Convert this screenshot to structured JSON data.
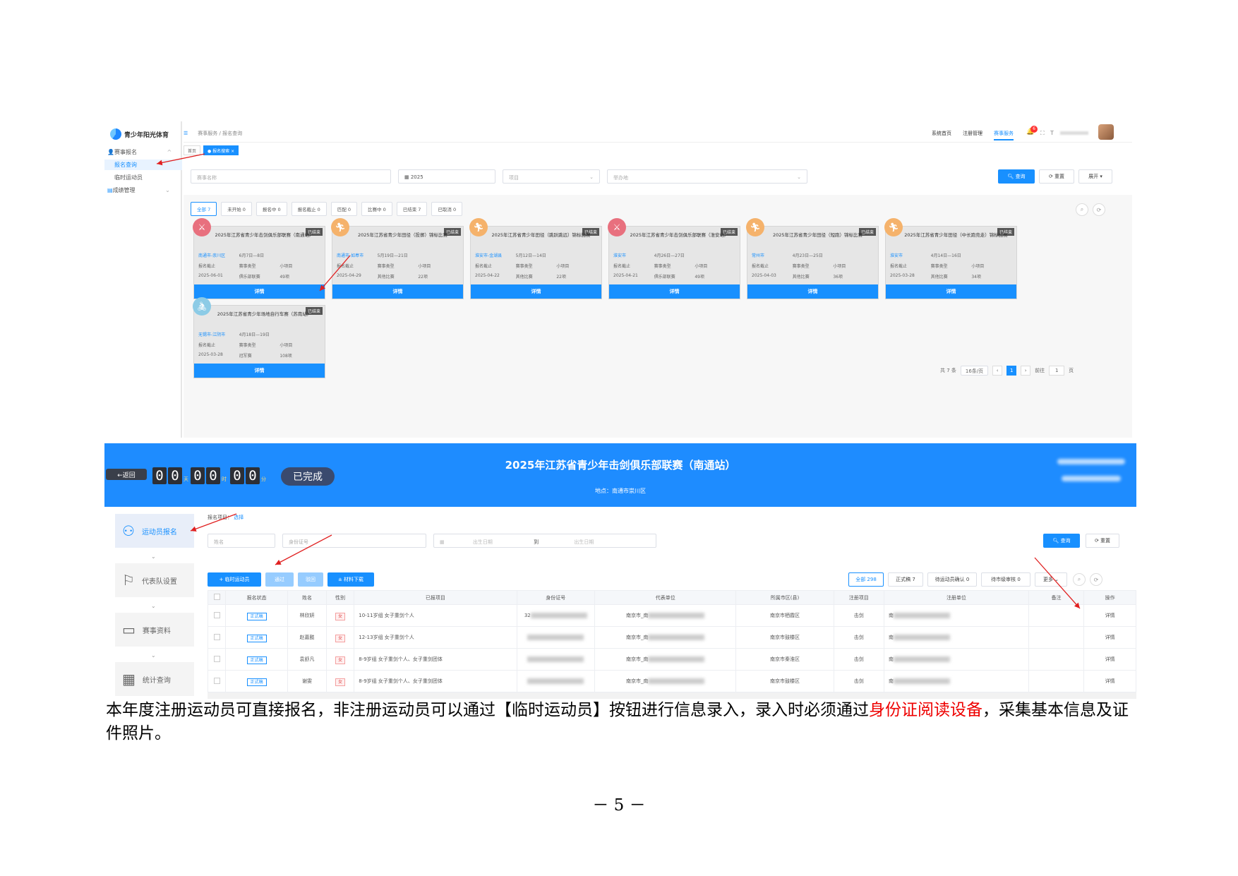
{
  "app": {
    "logo_text": "青少年阳光体育"
  },
  "sidebar": {
    "items": [
      {
        "label": "赛事报名"
      },
      {
        "label": "报名查询"
      },
      {
        "label": "临时运动员"
      },
      {
        "label": "成绩管理"
      }
    ]
  },
  "header": {
    "breadcrumb": "赛事服务 / 报名查询",
    "nav": [
      "系统首页",
      "注册管理",
      "赛事服务"
    ],
    "notification_count": "6",
    "tags": [
      "首页",
      "● 报名搜索 ×"
    ]
  },
  "filters": {
    "name_placeholder": "赛事名称",
    "year_value": "2025",
    "item_placeholder": "项目",
    "unit_placeholder": "举办地",
    "search_label": "查询",
    "reset_label": "重置",
    "expand_label": "展开"
  },
  "status_tabs": [
    "全部 7",
    "未开始 0",
    "报名中 0",
    "报名截止 0",
    "匹配 0",
    "比赛中 0",
    "已结束 7",
    "已取消 0"
  ],
  "cards": [
    {
      "title": "2025年江苏省青少年击剑俱乐部联赛（南通站）",
      "location": "南通市-崇川区",
      "dates": "6月7日—8日",
      "deadline_label": "报名截止",
      "type_label": "赛事类型",
      "sub_label": "小项目",
      "deadline": "2025-06-01",
      "type": "俱乐部联赛",
      "count": "49项",
      "status": "已结束",
      "detail": "详情",
      "icon": "fencing-icon",
      "color": "#e8707e"
    },
    {
      "title": "2025年江苏省青少年田径（投掷）锦标比赛",
      "location": "南通市-如皋市",
      "dates": "5月19日—21日",
      "deadline_label": "报名截止",
      "type_label": "赛事类型",
      "sub_label": "小项目",
      "deadline": "2025-04-29",
      "type": "其他比赛",
      "count": "22项",
      "status": "已结束",
      "detail": "详情",
      "icon": "running-icon",
      "color": "#f5b26b"
    },
    {
      "title": "2025年江苏省青少年田径（跳跃跳远）锦标比赛",
      "location": "淮安市-金湖县",
      "dates": "5月12日—14日",
      "deadline_label": "报名截止",
      "type_label": "赛事类型",
      "sub_label": "小项目",
      "deadline": "2025-04-22",
      "type": "其他比赛",
      "count": "22项",
      "status": "已结束",
      "detail": "详情",
      "icon": "running-icon",
      "color": "#f5b26b"
    },
    {
      "title": "2025年江苏省青少年击剑俱乐部联赛（淮安站）",
      "location": "淮安市",
      "dates": "4月26日—27日",
      "deadline_label": "报名截止",
      "type_label": "赛事类型",
      "sub_label": "小项目",
      "deadline": "2025-04-21",
      "type": "俱乐部联赛",
      "count": "49项",
      "status": "已结束",
      "detail": "详情",
      "icon": "fencing-icon",
      "color": "#e8707e"
    },
    {
      "title": "2025年江苏省青少年田径（短跑）锦标比赛",
      "location": "常州市",
      "dates": "4月23日—25日",
      "deadline_label": "报名截止",
      "type_label": "赛事类型",
      "sub_label": "小项目",
      "deadline": "2025-04-03",
      "type": "其他比赛",
      "count": "36项",
      "status": "已结束",
      "detail": "详情",
      "icon": "running-icon",
      "color": "#f5b26b"
    },
    {
      "title": "2025年江苏省青少年田径（中长跑竞走）锦标比赛",
      "location": "淮安市",
      "dates": "4月14日—16日",
      "deadline_label": "报名截止",
      "type_label": "赛事类型",
      "sub_label": "小项目",
      "deadline": "2025-03-28",
      "type": "其他比赛",
      "count": "34项",
      "status": "已结束",
      "detail": "详情",
      "icon": "running-icon",
      "color": "#f5b26b"
    },
    {
      "title": "2025年江苏省青少年场地自行车赛（苏南站）",
      "location": "无锡市-江阴市",
      "dates": "4月18日—19日",
      "deadline_label": "报名截止",
      "type_label": "赛事类型",
      "sub_label": "小项目",
      "deadline": "2025-03-28",
      "type": "冠军赛",
      "count": "108项",
      "status": "已结束",
      "detail": "详情",
      "icon": "cycling-icon",
      "color": "#8ccbe6"
    }
  ],
  "pagination": {
    "total": "共 7 条",
    "page_size": "16条/页",
    "current": "1",
    "goto_label": "前往",
    "goto_value": "1",
    "page_suffix": "页"
  },
  "event": {
    "back_label": "←返回",
    "countdown": {
      "d1": "0",
      "d2": "0",
      "day": "天",
      "h1": "0",
      "h2": "0",
      "hour": "时",
      "m1": "0",
      "m2": "0",
      "min": "分"
    },
    "status": "已完成",
    "title": "2025年江苏省青少年击剑俱乐部联赛（南通站）",
    "location": "地点：南通市崇川区"
  },
  "event_menu": [
    {
      "label": "运动员报名",
      "icon": "person-icon"
    },
    {
      "label": "代表队设置",
      "icon": "flag-icon"
    },
    {
      "label": "赛事资料",
      "icon": "folder-icon"
    },
    {
      "label": "统计查询",
      "icon": "chart-icon"
    }
  ],
  "athlete_filters": {
    "item_label": "报名项目：",
    "item_select": "选择",
    "name_placeholder": "姓名",
    "id_placeholder": "身份证号",
    "date_from": "出生日期",
    "date_to_label": "到",
    "date_to": "出生日期",
    "search_label": "查询",
    "reset_label": "重置"
  },
  "athlete_toolbar": {
    "temp_button": "+ 临时运动员",
    "pass_button": "通过",
    "reject_button": "驳回",
    "download_button": "± 材料下载",
    "tabs": [
      "全部 298",
      "正式稿 7",
      "待运动员确认 0",
      "待市级审核 0",
      "更多"
    ]
  },
  "athlete_table": {
    "headers": [
      "",
      "报名状态",
      "姓名",
      "性别",
      "已报项目",
      "身份证号",
      "代表单位",
      "所属市区(县)",
      "注册项目",
      "注册单位",
      "备注",
      "操作"
    ],
    "rows": [
      {
        "status": "正式稿",
        "name": "林欣妍",
        "gender": "女",
        "items": "10-11岁组 女子重剑个人",
        "id": "32",
        "unit": "南京市_南",
        "district": "南京市栖霞区",
        "sport": "击剑",
        "reg_unit": "南",
        "note": "",
        "op": "详情"
      },
      {
        "status": "正式稿",
        "name": "赵嘉懿",
        "gender": "女",
        "items": "12-13岁组 女子重剑个人",
        "id": "",
        "unit": "南京市_南",
        "district": "南京市鼓楼区",
        "sport": "击剑",
        "reg_unit": "南",
        "note": "",
        "op": "详情"
      },
      {
        "status": "正式稿",
        "name": "袁舒凡",
        "gender": "女",
        "items": "8-9岁组 女子重剑个人、女子重剑团体",
        "id": "",
        "unit": "南京市_南",
        "district": "南京市秦淮区",
        "sport": "击剑",
        "reg_unit": "南",
        "note": "",
        "op": "详情"
      },
      {
        "status": "正式稿",
        "name": "谢雯",
        "gender": "女",
        "items": "8-9岁组 女子重剑个人、女子重剑团体",
        "id": "",
        "unit": "南京市_南",
        "district": "南京市鼓楼区",
        "sport": "击剑",
        "reg_unit": "南",
        "note": "",
        "op": "详情"
      }
    ]
  },
  "paragraph": {
    "part1": "本年度注册运动员可直接报名，非注册运动员可以通过【临时运动员】按钮进行信息录入，录入时必须通过",
    "highlight": "身份证阅读设备",
    "part2": "，采集基本信息及证件照片。"
  },
  "page_number": "－ 5 －"
}
